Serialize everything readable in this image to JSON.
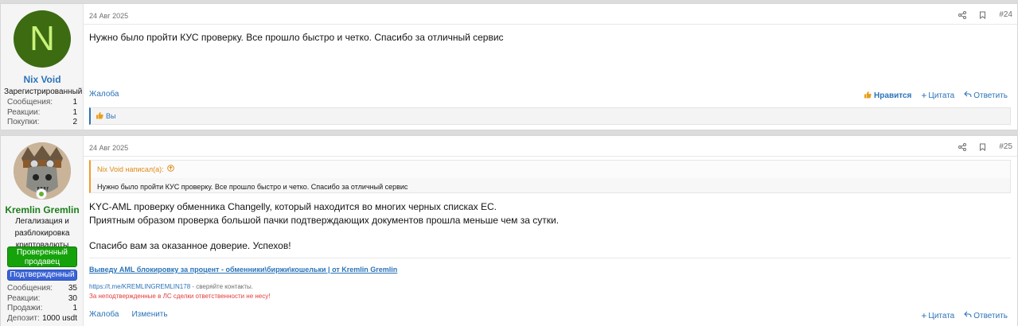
{
  "posts": [
    {
      "user": {
        "avatar_letter": "N",
        "avatar_color": "#3c6b12",
        "name": "Nix Void",
        "title": "Зарегистрированный",
        "stats": [
          {
            "label": "Сообщения:",
            "value": "1"
          },
          {
            "label": "Реакции:",
            "value": "1"
          },
          {
            "label": "Покупки:",
            "value": "2"
          }
        ]
      },
      "date": "24 Авг 2025",
      "number": "#24",
      "text": "Нужно было пройти КУС проверку. Все прошло быстро и четко. Спасибо за отличный сервис",
      "actions_left": [
        "Жалоба"
      ],
      "actions_right": {
        "like": "Нравится",
        "quote": "Цитата",
        "reply": "Ответить"
      },
      "reactions": "Вы"
    },
    {
      "user": {
        "name": "Kremlin Gremlin",
        "title": "Легализация и разблокировка криптовалюты",
        "badges": [
          "Проверенный продавец",
          "Подтвержденный"
        ],
        "stats": [
          {
            "label": "Сообщения:",
            "value": "35"
          },
          {
            "label": "Реакции:",
            "value": "30"
          },
          {
            "label": "Продажи:",
            "value": "1"
          },
          {
            "label": "Депозит:",
            "value": "1000 usdt"
          }
        ]
      },
      "date": "24 Авг 2025",
      "number": "#25",
      "quote": {
        "author": "Nix Void написал(а):",
        "text": "Нужно было пройти КУС проверку. Все прошло быстро и четко. Спасибо за отличный сервис"
      },
      "text_lines": [
        "KYC-AML проверку обменника Changelly, который находится во многих черных списках ЕС.",
        "Приятным образом проверка большой пачки подтверждающих документов прошла меньше чем за сутки.",
        "Спасибо вам за оказанное доверие. Успехов!"
      ],
      "signature": {
        "link": "Выведу AML блокировку за процент - обменники\\биржи\\кошельки | от Kremlin Gremlin",
        "contact_url": "https://t.me/KREMLINGREMLIN178",
        "contact_suffix": " - сверяйте контакты.",
        "warning": "За неподтвержденные в ЛС сделки ответственности не несу!"
      },
      "actions_left": [
        "Жалоба",
        "Изменить"
      ],
      "actions_right": {
        "quote": "Цитата",
        "reply": "Ответить"
      }
    }
  ]
}
